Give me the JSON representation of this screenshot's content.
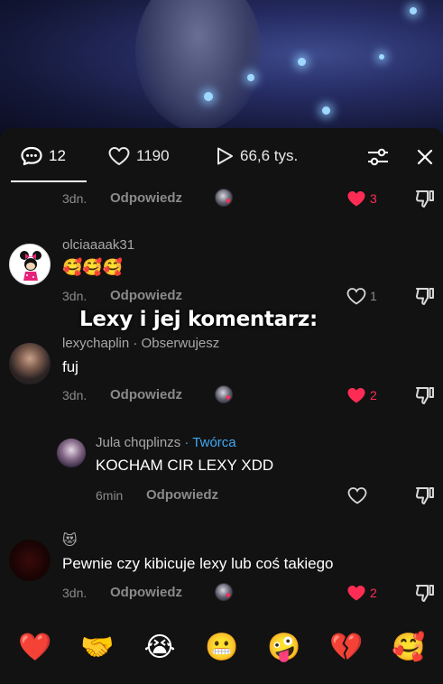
{
  "header": {
    "comments_count": "12",
    "likes_count": "1190",
    "views_count": "66,6 tys."
  },
  "overlay_caption": "Lexy i jej komentarz:",
  "comments": [
    {
      "time": "3dn.",
      "reply_label": "Odpowiedz",
      "likes": "3",
      "liked": true,
      "creator_liked": true
    },
    {
      "username": "olciaaaak31",
      "text": "🥰🥰🥰",
      "time": "3dn.",
      "reply_label": "Odpowiedz",
      "likes": "1",
      "liked": false
    },
    {
      "username": "lexychaplin",
      "status": "· Obserwujesz",
      "text": "fuj",
      "time": "3dn.",
      "reply_label": "Odpowiedz",
      "likes": "2",
      "liked": true,
      "creator_liked": true
    },
    {
      "username": "Jula chqplinzs",
      "badge": "· Twórca",
      "text": "KOCHAM CIR LEXY XDD",
      "time": "6min",
      "reply_label": "Odpowiedz",
      "likes": "",
      "liked": false
    },
    {
      "username_emoji": "😻",
      "text": "Pewnie czy kibicuje lexy lub coś takiego",
      "time": "3dn.",
      "reply_label": "Odpowiedz",
      "likes": "2",
      "liked": true,
      "creator_liked": true
    }
  ],
  "reactions": [
    "❤️",
    "🤝",
    "😭",
    "😬",
    "🤪",
    "💔",
    "🥰"
  ],
  "colors": {
    "sheet_bg": "#121212",
    "like_red": "#fe2c55",
    "creator_badge": "#3fa9f5",
    "muted_text": "#8a8a8a"
  }
}
